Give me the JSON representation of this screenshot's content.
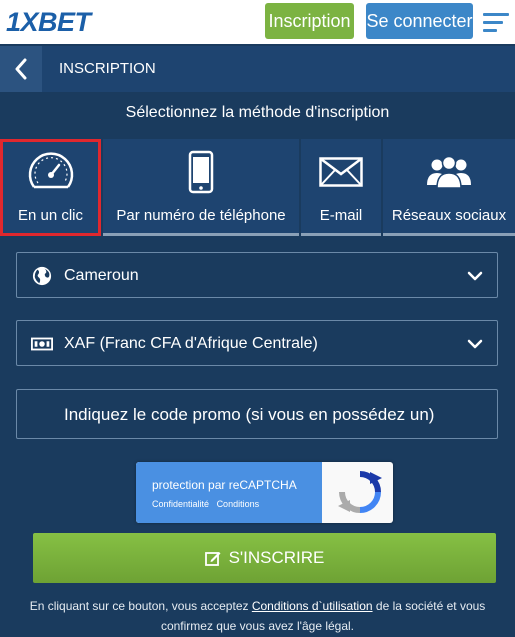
{
  "header": {
    "logo": "1XBET",
    "inscription_label": "Inscription",
    "connect_label": "Se connecter"
  },
  "nav": {
    "title": "INSCRIPTION"
  },
  "heading": "Sélectionnez la méthode d'inscription",
  "tabs": [
    {
      "label": "En un clic",
      "icon": "speedometer-icon",
      "active": true
    },
    {
      "label": "Par numéro de téléphone",
      "icon": "phone-icon",
      "active": false
    },
    {
      "label": "E-mail",
      "icon": "envelope-icon",
      "active": false
    },
    {
      "label": "Réseaux sociaux",
      "icon": "people-icon",
      "active": false
    }
  ],
  "form": {
    "country_value": "Cameroun",
    "currency_value": "XAF (Franc CFA d'Afrique Centrale)",
    "promo_placeholder": "Indiquez le code promo (si vous en possédez un)"
  },
  "recaptcha": {
    "title": "protection par reCAPTCHA",
    "privacy": "Confidentialité",
    "terms": "Conditions"
  },
  "submit_label": "S'INSCRIRE",
  "terms_text": {
    "before": "En cliquant sur ce bouton, vous acceptez ",
    "link": "Conditions d`utilisation",
    "after": " de la société et vous confirmez que vous avez l'âge légal."
  },
  "colors": {
    "background": "#1a3b5e",
    "accent_green": "#7cb342",
    "accent_blue": "#3c87c8",
    "active_tab_border": "#e0282e"
  }
}
